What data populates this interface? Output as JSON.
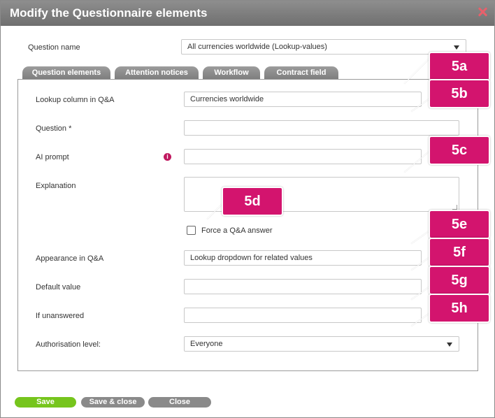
{
  "dialog": {
    "title": "Modify the Questionnaire elements"
  },
  "question_name": {
    "label": "Question name",
    "value": "All currencies worldwide (Lookup-values)"
  },
  "tabs": [
    {
      "label": "Question elements",
      "active": true
    },
    {
      "label": "Attention notices"
    },
    {
      "label": "Workflow"
    },
    {
      "label": "Contract field"
    }
  ],
  "form": {
    "lookup_column": {
      "label": "Lookup column in Q&A",
      "value": "Currencies worldwide"
    },
    "question": {
      "label": "Question *",
      "value": ""
    },
    "ai_prompt": {
      "label": "AI prompt",
      "value": "",
      "info_icon": "info-icon",
      "info_glyph": "i"
    },
    "explanation": {
      "label": "Explanation",
      "value": ""
    },
    "force_answer": {
      "label": "Force a Q&A answer",
      "checked": false
    },
    "appearance": {
      "label": "Appearance in Q&A",
      "value": "Lookup dropdown for related values"
    },
    "default_value": {
      "label": "Default value",
      "value": ""
    },
    "if_unanswered": {
      "label": "If unanswered",
      "value": ""
    },
    "authorisation": {
      "label": "Authorisation level:",
      "value": "Everyone"
    }
  },
  "callouts": [
    "5a",
    "5b",
    "5c",
    "5d",
    "5e",
    "5f",
    "5g",
    "5h"
  ],
  "buttons": {
    "save": "Save",
    "save_close": "Save & close",
    "close": "Close"
  },
  "colors": {
    "callout": "#d3146e",
    "save": "#76c51d",
    "secondary": "#8a8a8a",
    "close_icon": "#e8606b"
  }
}
